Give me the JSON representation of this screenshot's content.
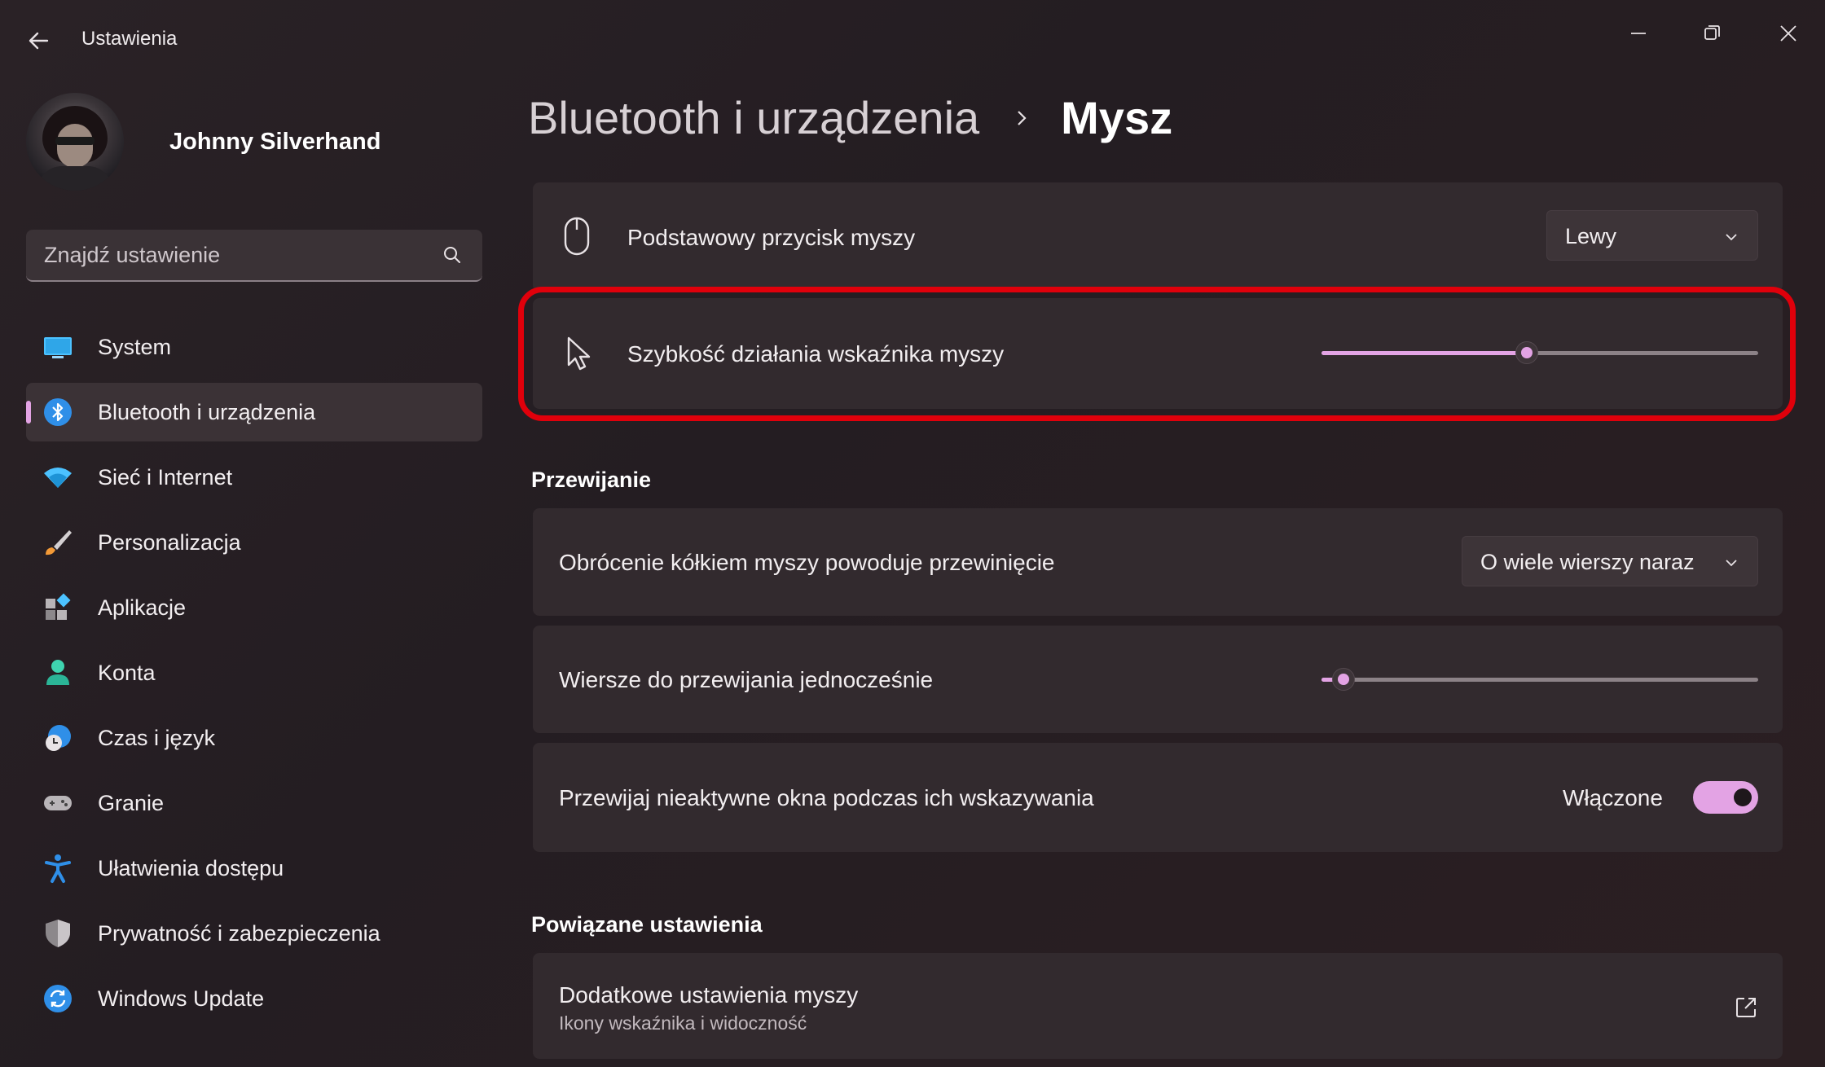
{
  "window": {
    "title": "Ustawienia",
    "controls": [
      "minimize-icon",
      "restore-icon",
      "close-icon"
    ]
  },
  "profile": {
    "name": "Johnny Silverhand"
  },
  "search": {
    "placeholder": "Znajdź ustawienie"
  },
  "sidebar": {
    "items": [
      {
        "label": "System",
        "icon": "system-icon",
        "selected": false
      },
      {
        "label": "Bluetooth i urządzenia",
        "icon": "bluetooth-icon",
        "selected": true
      },
      {
        "label": "Sieć i Internet",
        "icon": "wifi-icon",
        "selected": false
      },
      {
        "label": "Personalizacja",
        "icon": "brush-icon",
        "selected": false
      },
      {
        "label": "Aplikacje",
        "icon": "apps-icon",
        "selected": false
      },
      {
        "label": "Konta",
        "icon": "account-icon",
        "selected": false
      },
      {
        "label": "Czas i język",
        "icon": "time-language-icon",
        "selected": false
      },
      {
        "label": "Granie",
        "icon": "gamepad-icon",
        "selected": false
      },
      {
        "label": "Ułatwienia dostępu",
        "icon": "accessibility-icon",
        "selected": false
      },
      {
        "label": "Prywatność i zabezpieczenia",
        "icon": "shield-icon",
        "selected": false
      },
      {
        "label": "Windows Update",
        "icon": "windows-update-icon",
        "selected": false
      }
    ]
  },
  "breadcrumb": {
    "parent": "Bluetooth i urządzenia",
    "current": "Mysz"
  },
  "main": {
    "primary_button": {
      "label": "Podstawowy przycisk myszy",
      "value": "Lewy"
    },
    "pointer_speed": {
      "label": "Szybkość działania wskaźnika myszy",
      "level": 0.47
    },
    "scrolling": {
      "heading": "Przewijanie",
      "wheel_scroll": {
        "label": "Obrócenie kółkiem myszy powoduje przewinięcie",
        "value": "O wiele wierszy naraz"
      },
      "lines_to_scroll": {
        "label": "Wiersze do przewijania jednocześnie",
        "level": 0.05
      },
      "inactive_scroll": {
        "label": "Przewijaj nieaktywne okna podczas ich wskazywania",
        "state": "Włączone",
        "on": true
      }
    },
    "related": {
      "heading": "Powiązane ustawienia",
      "additional": {
        "title": "Dodatkowe ustawienia myszy",
        "subtitle": "Ikony wskaźnika i widoczność"
      }
    }
  },
  "colors": {
    "accent": "#e3a3e4",
    "background": "#2a2226",
    "card": "#322a2e",
    "highlight_outline": "#e0000b"
  }
}
